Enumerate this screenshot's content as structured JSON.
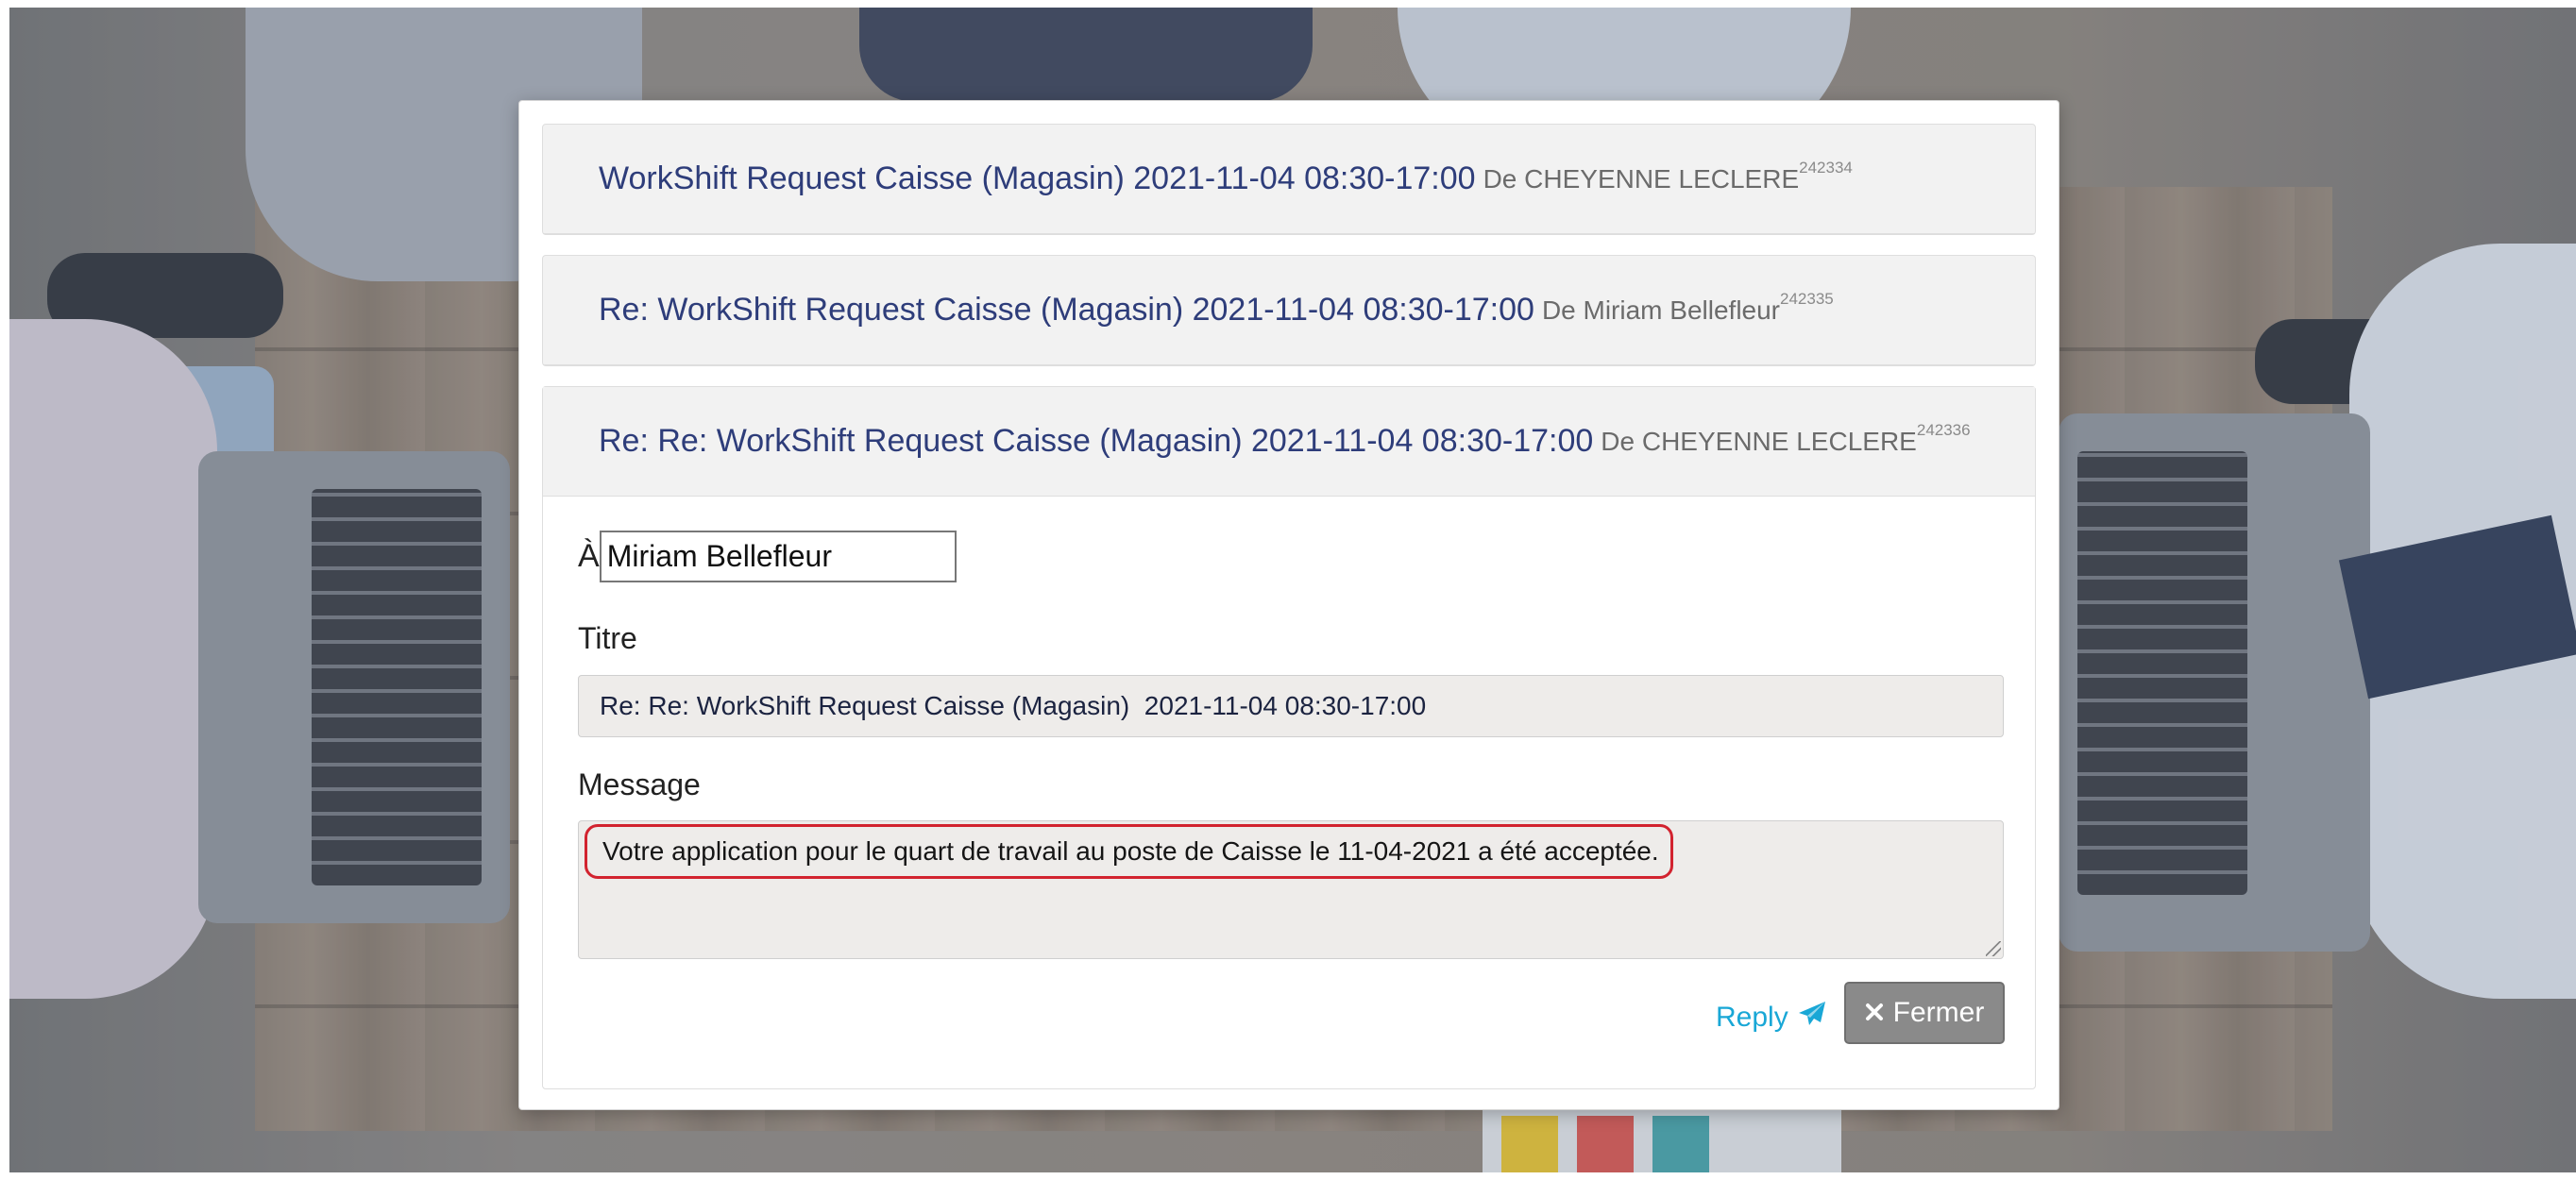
{
  "messages": [
    {
      "title": "WorkShift Request Caisse (Magasin) 2021-11-04 08:30-17:00",
      "from": "De CHEYENNE LECLERE",
      "id": "242334"
    },
    {
      "title": "Re: WorkShift Request Caisse (Magasin) 2021-11-04 08:30-17:00",
      "from": "De Miriam Bellefleur",
      "id": "242335"
    },
    {
      "title": "Re: Re: WorkShift Request Caisse (Magasin) 2021-11-04 08:30-17:00",
      "from": "De CHEYENNE LECLERE",
      "id": "242336"
    }
  ],
  "reply_form": {
    "to_label": "À",
    "to_value": "Miriam Bellefleur",
    "title_label": "Titre",
    "title_value": "Re: Re: WorkShift Request Caisse (Magasin)  2021-11-04 08:30-17:00",
    "message_label": "Message",
    "message_value": "Votre application pour le quart de travail  au poste de Caisse le 11-04-2021 a été acceptée.",
    "reply_label": "Reply",
    "reply_icon": "paper-plane-icon",
    "close_label": "Fermer",
    "close_icon": "close-icon"
  },
  "colors": {
    "title_text": "#2e3d7a",
    "highlight_border": "#d2232f",
    "reply_link": "#19a7d6",
    "close_button": "#8a8a8a"
  }
}
